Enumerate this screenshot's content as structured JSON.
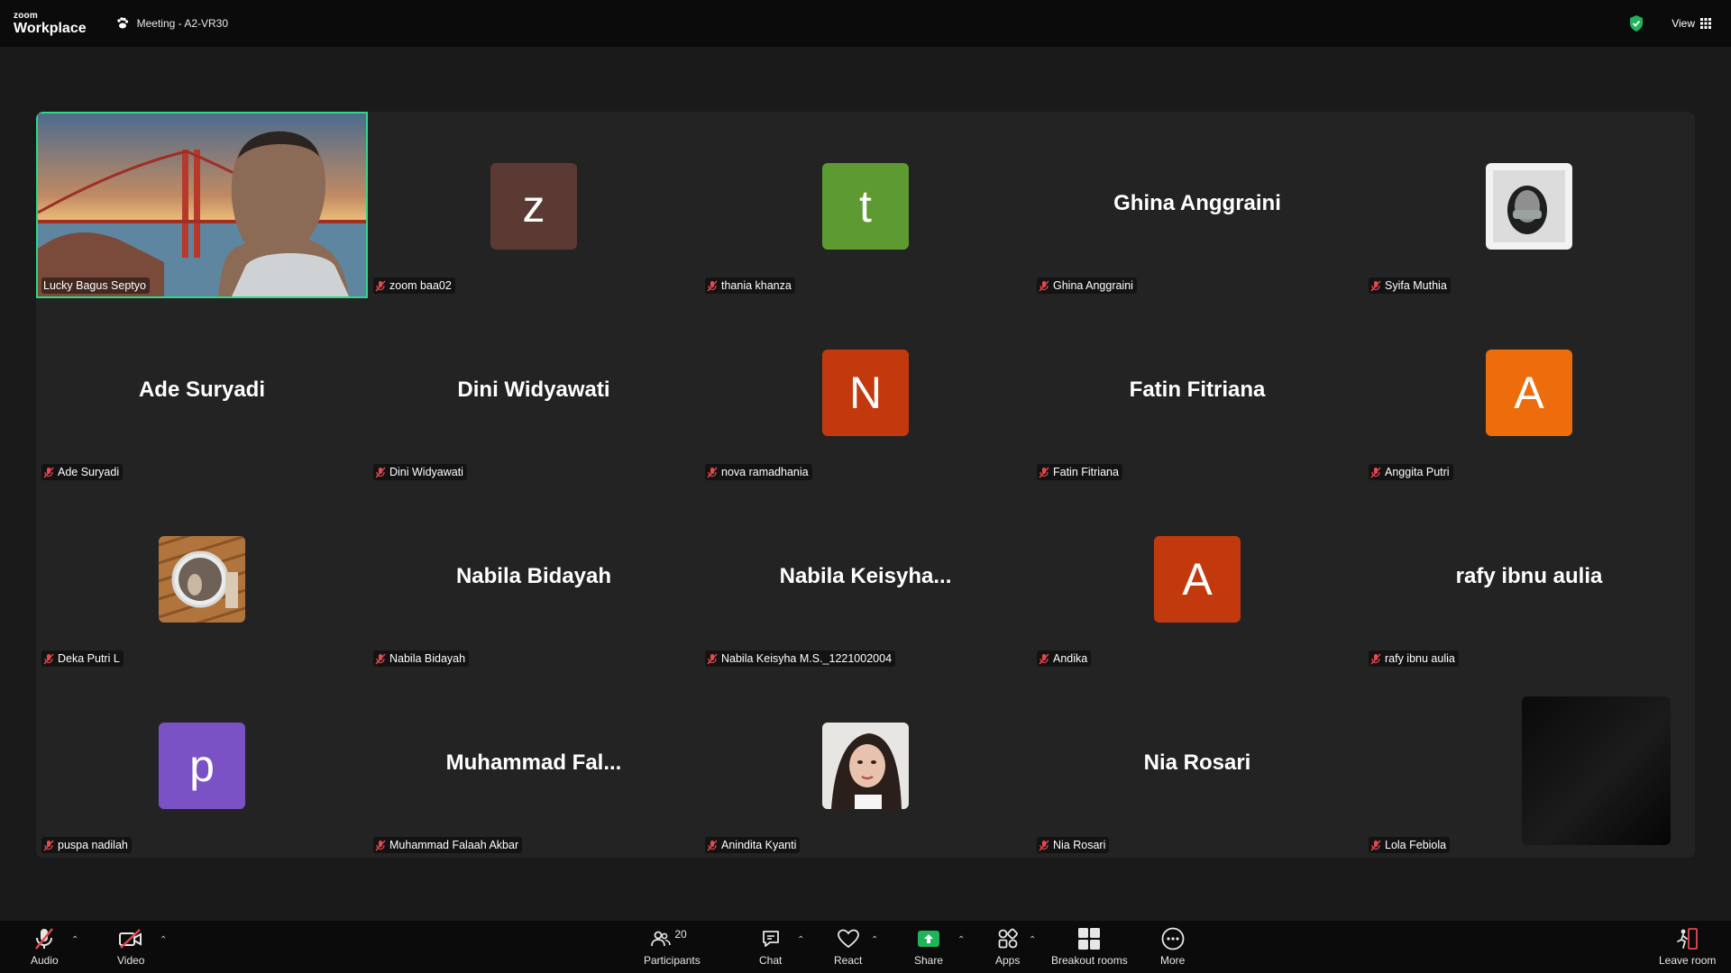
{
  "app": {
    "brand_top": "zoom",
    "brand_bottom": "Workplace",
    "meeting_title": "Meeting - A2-VR30",
    "view_label": "View"
  },
  "participants": [
    {
      "label": "Lucky Bagus Septyo",
      "type": "video"
    },
    {
      "label": "zoom baa02",
      "type": "letter",
      "letter": "z",
      "color": "#5b3a33"
    },
    {
      "label": "thania khanza",
      "type": "letter",
      "letter": "t",
      "color": "#5d9b32"
    },
    {
      "label": "Ghina Anggraini",
      "type": "name",
      "display": "Ghina Anggraini"
    },
    {
      "label": "Syifa Muthia",
      "type": "photo",
      "photo": "syifa"
    },
    {
      "label": "Ade Suryadi",
      "type": "name",
      "display": "Ade Suryadi"
    },
    {
      "label": "Dini Widyawati",
      "type": "name",
      "display": "Dini Widyawati"
    },
    {
      "label": "nova ramadhania",
      "type": "letter",
      "letter": "N",
      "color": "#c3390e"
    },
    {
      "label": "Fatin Fitriana",
      "type": "name",
      "display": "Fatin Fitriana"
    },
    {
      "label": "Anggita Putri",
      "type": "letter",
      "letter": "A",
      "color": "#ed6c0c"
    },
    {
      "label": "Deka Putri L",
      "type": "photo",
      "photo": "deka"
    },
    {
      "label": "Nabila Bidayah",
      "type": "name",
      "display": "Nabila Bidayah"
    },
    {
      "label": "Nabila Keisyha M.S._1221002004",
      "type": "name",
      "display": "Nabila  Keisyha..."
    },
    {
      "label": "Andika",
      "type": "letter",
      "letter": "A",
      "color": "#c3390e"
    },
    {
      "label": "rafy ibnu aulia",
      "type": "name",
      "display": "rafy ibnu aulia"
    },
    {
      "label": "puspa nadilah",
      "type": "letter",
      "letter": "p",
      "color": "#7b52c6"
    },
    {
      "label": "Muhammad Falaah Akbar",
      "type": "name",
      "display": "Muhammad  Fal..."
    },
    {
      "label": "Anindita Kyanti",
      "type": "photo",
      "photo": "anindita"
    },
    {
      "label": "Nia Rosari",
      "type": "name",
      "display": "Nia Rosari"
    },
    {
      "label": "Lola Febiola",
      "type": "dark"
    }
  ],
  "toolbar": {
    "audio": "Audio",
    "video": "Video",
    "participants": "Participants",
    "participants_count": "20",
    "chat": "Chat",
    "react": "React",
    "share": "Share",
    "apps": "Apps",
    "breakout": "Breakout rooms",
    "more": "More",
    "leave": "Leave room"
  }
}
